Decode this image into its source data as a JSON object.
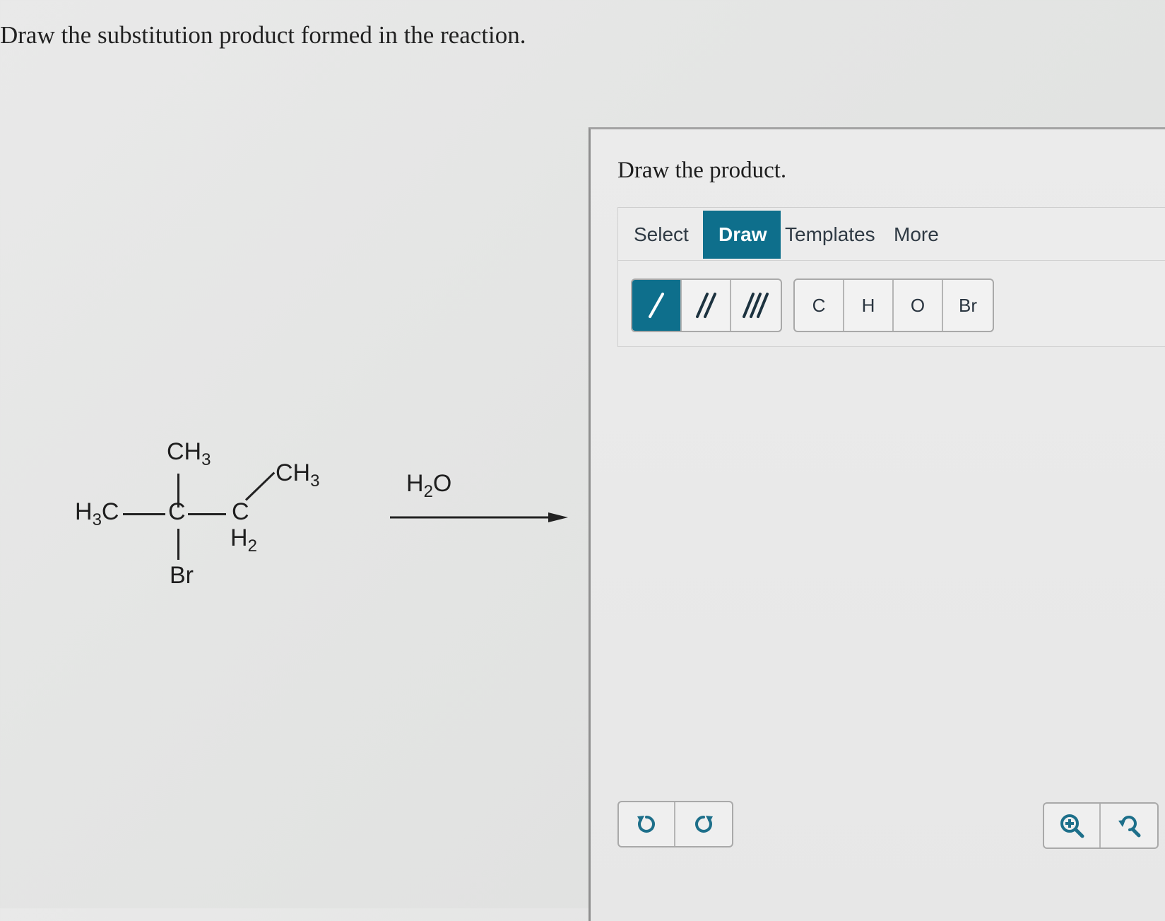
{
  "question": "Draw the substitution product formed in the reaction.",
  "reaction": {
    "ch3_top": "CH",
    "ch3_top_sub": "3",
    "h3c_left_pre": "H",
    "h3c_left_sub": "3",
    "h3c_left_post": "C",
    "center_c": "C",
    "ch2_c": "C",
    "ch2_h": "H",
    "ch2_sub": "2",
    "ch3_right": "CH",
    "ch3_right_sub": "3",
    "br": "Br",
    "reagent_pre": "H",
    "reagent_sub": "2",
    "reagent_post": "O"
  },
  "panel": {
    "title": "Draw the product.",
    "tabs": [
      {
        "label": "Select"
      },
      {
        "label": "Draw"
      },
      {
        "label": "Templates"
      },
      {
        "label": "More"
      }
    ],
    "atoms": [
      "C",
      "H",
      "O",
      "Br"
    ],
    "colors": {
      "accent": "#0e6f8c",
      "icon": "#1d6f8a"
    }
  }
}
